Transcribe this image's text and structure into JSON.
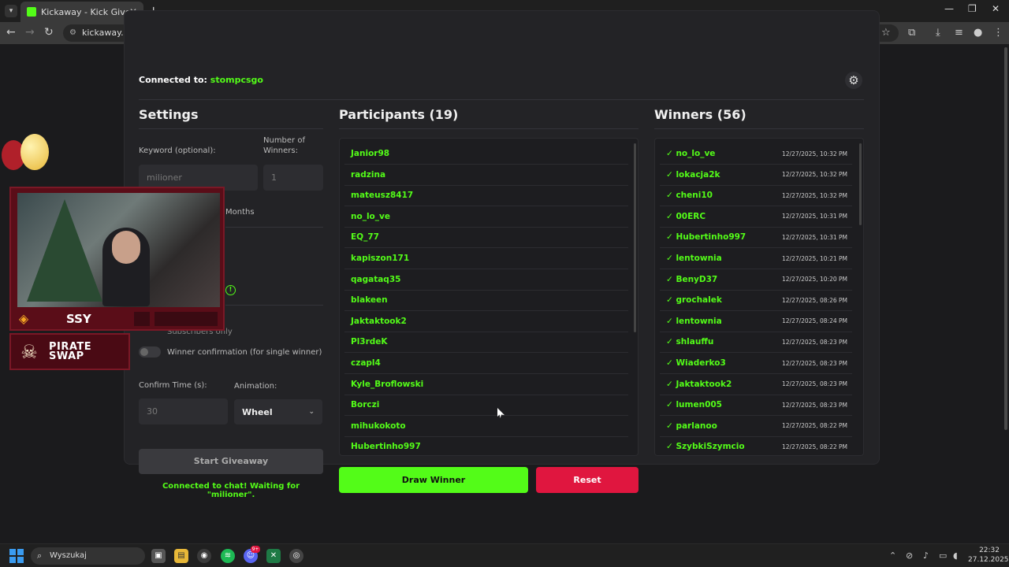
{
  "browser": {
    "tab_title": "Kickaway - Kick Giveaway Tool",
    "url": "kickaway.co"
  },
  "header": {
    "connected_label": "Connected to:",
    "channel": "stompcsgo"
  },
  "settings": {
    "title": "Settings",
    "keyword_label": "Keyword (optional):",
    "keyword_placeholder": "milioner",
    "winners_label": "Number of Winners:",
    "winners_placeholder": "1",
    "months_label": "Months",
    "subscribers_label": "Subscribers only",
    "confirmation_label": "Winner confirmation (for single winner)",
    "confirm_time_label": "Confirm Time (s):",
    "confirm_time_placeholder": "30",
    "animation_label": "Animation:",
    "animation_value": "Wheel",
    "start_button": "Start Giveaway",
    "status": "Connected to chat! Waiting for \"milioner\"."
  },
  "participants": {
    "title": "Participants (19)",
    "items": [
      "Janior98",
      "radzina",
      "mateusz8417",
      "no_lo_ve",
      "EQ_77",
      "kapiszon171",
      "qagataq35",
      "blakeen",
      "Jaktaktook2",
      "Pl3rdeK",
      "czapl4",
      "Kyle_Broflowski",
      "Borczi",
      "mihukokoto",
      "Hubertinho997"
    ]
  },
  "winners": {
    "title": "Winners (56)",
    "items": [
      {
        "name": "✓ no_lo_ve",
        "time": "12/27/2025, 10:32 PM"
      },
      {
        "name": "✓ lokacja2k",
        "time": "12/27/2025, 10:32 PM"
      },
      {
        "name": "✓ cheni10",
        "time": "12/27/2025, 10:32 PM"
      },
      {
        "name": "✓ 00ERC",
        "time": "12/27/2025, 10:31 PM"
      },
      {
        "name": "✓ Hubertinho997",
        "time": "12/27/2025, 10:31 PM"
      },
      {
        "name": "✓ lentownia",
        "time": "12/27/2025, 10:21 PM"
      },
      {
        "name": "✓ BenyD37",
        "time": "12/27/2025, 10:20 PM"
      },
      {
        "name": "✓ grochalek",
        "time": "12/27/2025, 08:26 PM"
      },
      {
        "name": "✓ lentownia",
        "time": "12/27/2025, 08:24 PM"
      },
      {
        "name": "✓ shlauffu",
        "time": "12/27/2025, 08:23 PM"
      },
      {
        "name": "✓ Wiaderko3",
        "time": "12/27/2025, 08:23 PM"
      },
      {
        "name": "✓ Jaktaktook2",
        "time": "12/27/2025, 08:23 PM"
      },
      {
        "name": "✓ lumen005",
        "time": "12/27/2025, 08:23 PM"
      },
      {
        "name": "✓ parlanoo",
        "time": "12/27/2025, 08:22 PM"
      },
      {
        "name": "✓ SzybkiSzymcio",
        "time": "12/27/2025, 08:22 PM"
      }
    ]
  },
  "actions": {
    "draw": "Draw Winner",
    "reset": "Reset"
  },
  "overlay": {
    "pirate_line1": "PIRATE",
    "pirate_line2": "SWAP",
    "logo_text": "SSY"
  },
  "taskbar": {
    "search_placeholder": "Wyszukaj",
    "time": "22:32",
    "date": "27.12.2025",
    "discord_badge": "9+"
  },
  "colors": {
    "accent": "#53fc18",
    "danger": "#e0163f"
  }
}
